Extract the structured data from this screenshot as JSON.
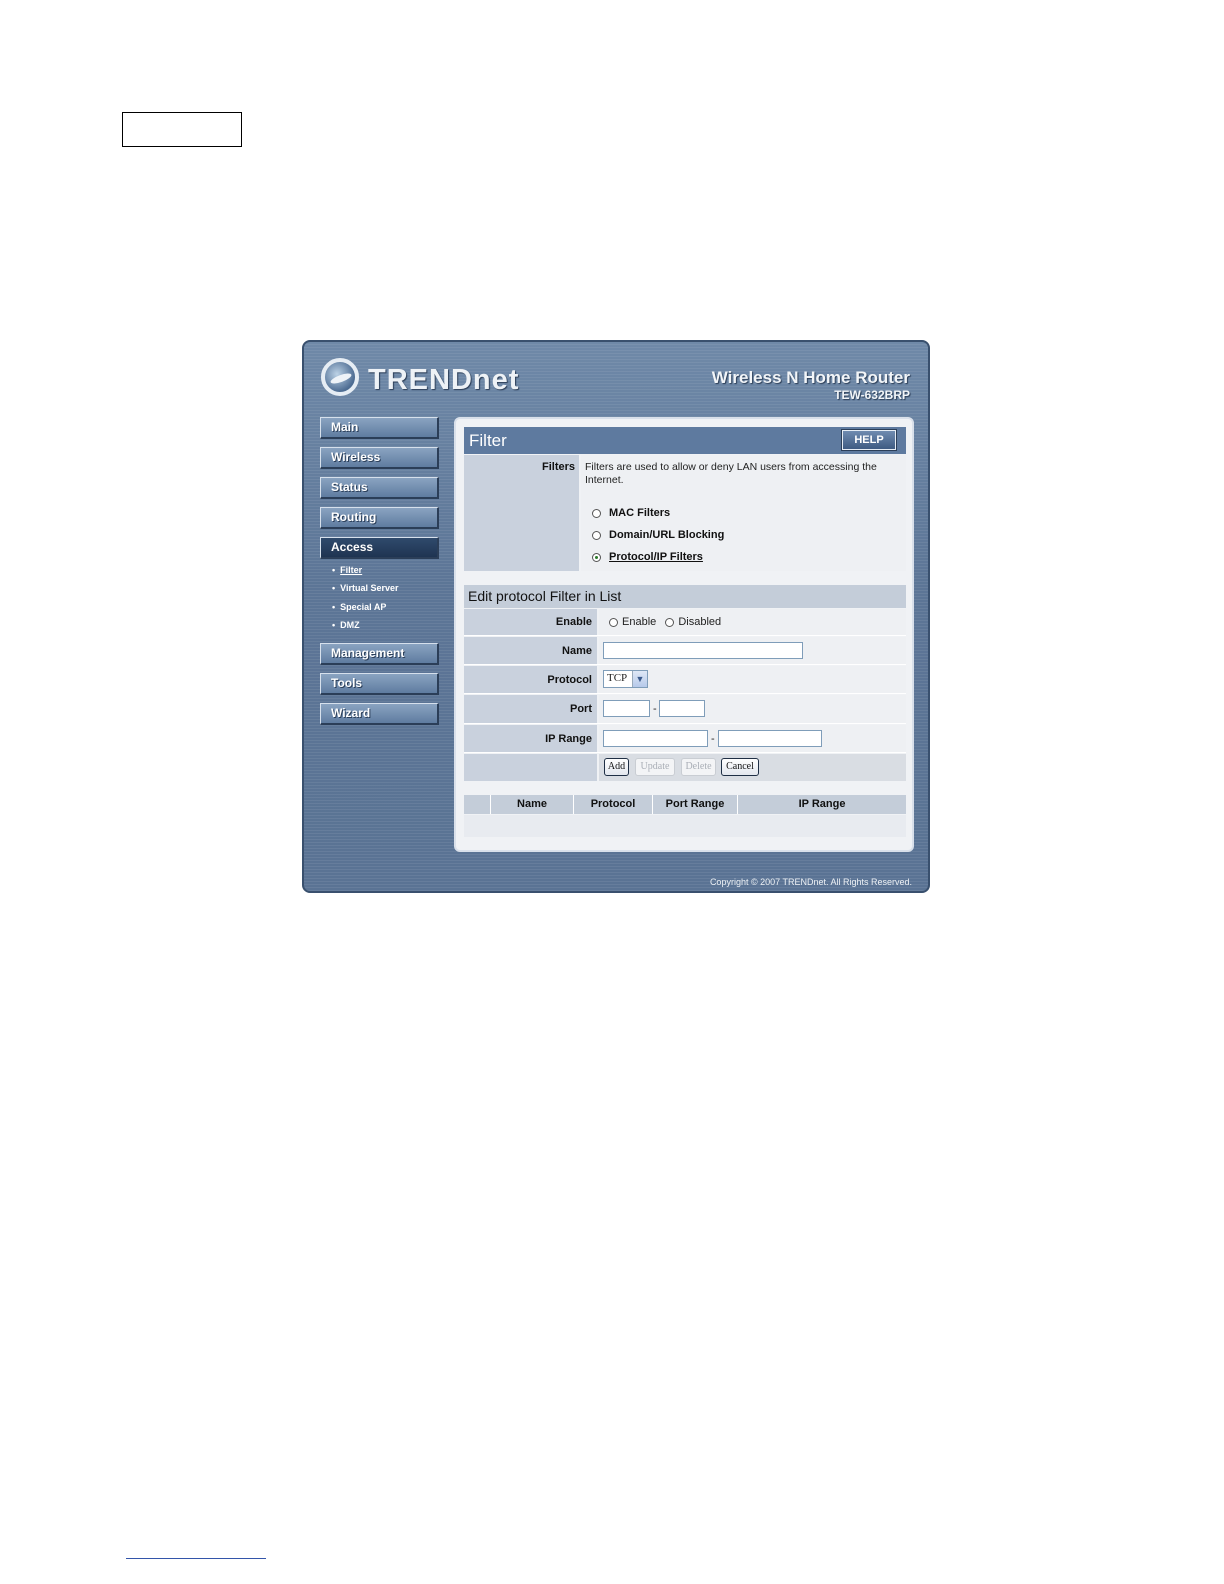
{
  "brand": {
    "logo_text": "TRENDnet"
  },
  "product": {
    "title": "Wireless N Home Router",
    "model": "TEW-632BRP"
  },
  "sidebar": {
    "items": [
      {
        "label": "Main"
      },
      {
        "label": "Wireless"
      },
      {
        "label": "Status"
      },
      {
        "label": "Routing"
      },
      {
        "label": "Access",
        "active": true
      },
      {
        "label": "Management"
      },
      {
        "label": "Tools"
      },
      {
        "label": "Wizard"
      }
    ],
    "access_subitems": [
      {
        "label": "Filter",
        "current": true
      },
      {
        "label": "Virtual Server"
      },
      {
        "label": "Special AP"
      },
      {
        "label": "DMZ"
      }
    ]
  },
  "filter_section": {
    "title": "Filter",
    "help_label": "HELP",
    "filters_label": "Filters",
    "description": "Filters are used to allow or deny LAN users from accessing the Internet.",
    "options": [
      {
        "label": "MAC Filters",
        "selected": false
      },
      {
        "label": "Domain/URL Blocking",
        "selected": false
      },
      {
        "label": "Protocol/IP Filters",
        "selected": true
      }
    ]
  },
  "edit_section": {
    "title": "Edit protocol Filter in List",
    "enable": {
      "label": "Enable",
      "option_enable": "Enable",
      "option_disabled": "Disabled"
    },
    "name": {
      "label": "Name",
      "value": ""
    },
    "protocol": {
      "label": "Protocol",
      "selected": "TCP"
    },
    "port": {
      "label": "Port",
      "from": "",
      "to": "",
      "separator": "-"
    },
    "ip_range": {
      "label": "IP Range",
      "from": "",
      "to": "",
      "separator": "-"
    },
    "buttons": {
      "add": "Add",
      "update": "Update",
      "delete": "Delete",
      "cancel": "Cancel"
    }
  },
  "list": {
    "columns": [
      "Name",
      "Protocol",
      "Port Range",
      "IP Range"
    ],
    "rows": []
  },
  "footer": {
    "copyright": "Copyright © 2007 TRENDnet. All Rights Reserved."
  }
}
